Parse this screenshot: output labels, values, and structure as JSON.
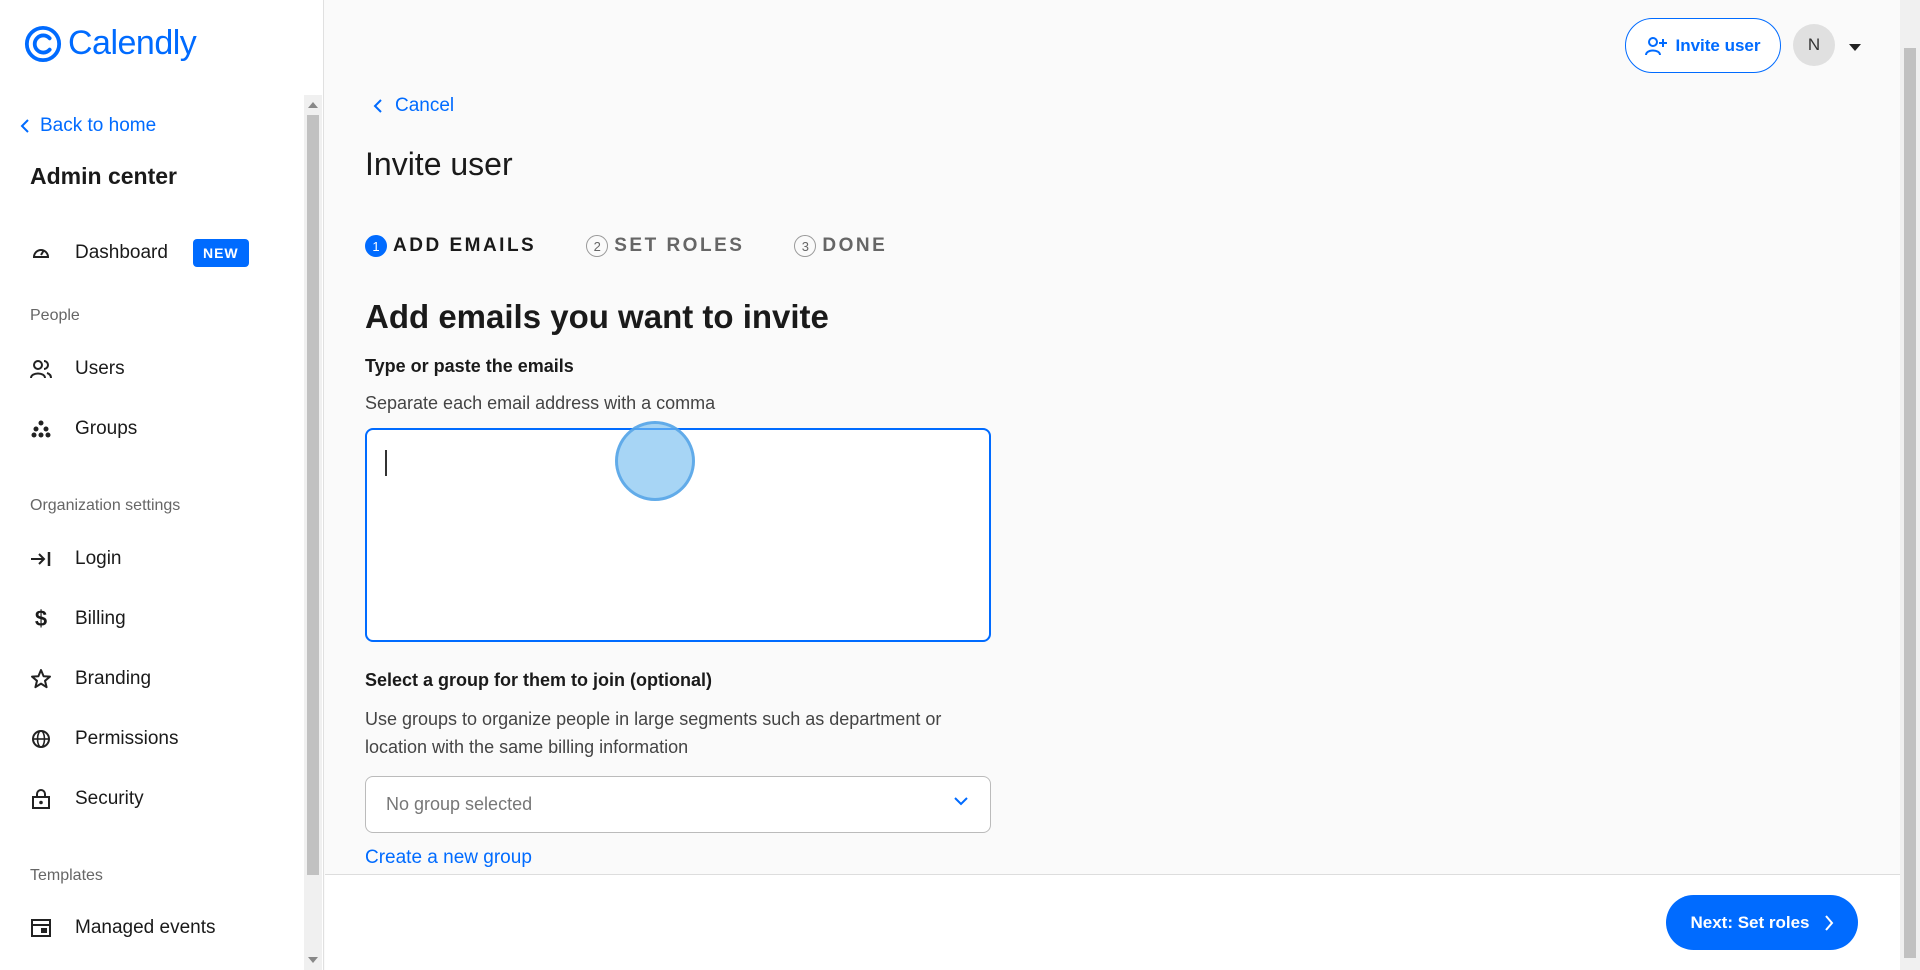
{
  "brand": {
    "name": "Calendly",
    "accent": "#006bff"
  },
  "sidebar": {
    "back_label": "Back to home",
    "title": "Admin center",
    "dashboard": {
      "label": "Dashboard",
      "badge": "NEW",
      "icon": "gauge-icon"
    },
    "people_section": "People",
    "people_items": [
      {
        "label": "Users",
        "icon": "users-icon"
      },
      {
        "label": "Groups",
        "icon": "groups-icon"
      }
    ],
    "org_section": "Organization settings",
    "org_items": [
      {
        "label": "Login",
        "icon": "login-icon"
      },
      {
        "label": "Billing",
        "icon": "dollar-icon"
      },
      {
        "label": "Branding",
        "icon": "star-icon"
      },
      {
        "label": "Permissions",
        "icon": "globe-icon"
      },
      {
        "label": "Security",
        "icon": "lock-icon"
      }
    ],
    "templates_section": "Templates",
    "template_items": [
      {
        "label": "Managed events",
        "icon": "calendar-card-icon"
      }
    ]
  },
  "header": {
    "invite_label": "Invite user",
    "avatar_initial": "N"
  },
  "main": {
    "cancel_label": "Cancel",
    "title": "Invite user",
    "steps": [
      {
        "num": "1",
        "label": "ADD EMAILS",
        "active": true
      },
      {
        "num": "2",
        "label": "SET ROLES",
        "active": false
      },
      {
        "num": "3",
        "label": "DONE",
        "active": false
      }
    ],
    "section_title": "Add emails you want to invite",
    "emails_label": "Type or paste the emails",
    "emails_help": "Separate each email address with a comma",
    "emails_value": "",
    "group_label": "Select a group for them to join (optional)",
    "group_help": "Use groups to organize people in large segments such as department or location with the same billing information",
    "group_select_value": "No group selected",
    "create_group_label": "Create a new group"
  },
  "footer": {
    "next_label": "Next: Set roles"
  }
}
